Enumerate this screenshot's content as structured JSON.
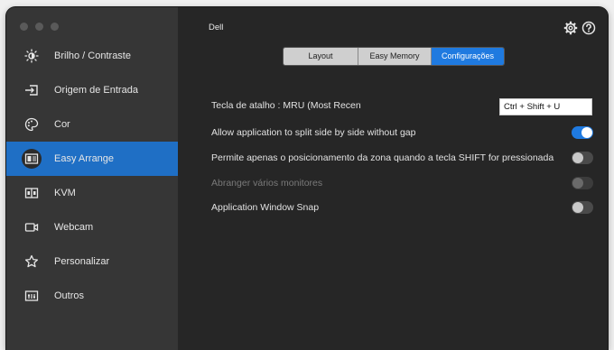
{
  "window": {
    "title": "Dell"
  },
  "sidebar": {
    "items": [
      {
        "label": "Brilho / Contraste",
        "icon": "brightness-icon",
        "active": false
      },
      {
        "label": "Origem de Entrada",
        "icon": "input-source-icon",
        "active": false
      },
      {
        "label": "Cor",
        "icon": "palette-icon",
        "active": false
      },
      {
        "label": "Easy Arrange",
        "icon": "easy-arrange-icon",
        "active": true
      },
      {
        "label": "KVM",
        "icon": "kvm-icon",
        "active": false
      },
      {
        "label": "Webcam",
        "icon": "webcam-icon",
        "active": false
      },
      {
        "label": "Personalizar",
        "icon": "star-icon",
        "active": false
      },
      {
        "label": "Outros",
        "icon": "others-icon",
        "active": false
      }
    ]
  },
  "header": {
    "settings_icon": "gear-icon",
    "help_icon": "help-icon"
  },
  "tabs": [
    {
      "label": "Layout",
      "active": false
    },
    {
      "label": "Easy Memory",
      "active": false
    },
    {
      "label": "Configurações",
      "active": true
    }
  ],
  "settings": {
    "shortcut_label": "Tecla de atalho : MRU (Most Recent Used)",
    "shortcut_value": "Ctrl + Shift + U",
    "rows": [
      {
        "label": "Allow application to split side by side without gap",
        "state": "on"
      },
      {
        "label": "Permite apenas o posicionamento da zona quando a tecla SHIFT for pressionada",
        "state": "off"
      },
      {
        "label": "Abranger vários monitores",
        "state": "disabled"
      },
      {
        "label": "Application Window Snap",
        "state": "off"
      }
    ]
  },
  "colors": {
    "accent": "#1f7ae0",
    "sidebar_active": "#1f6fc5",
    "sidebar_bg": "#363636",
    "main_bg": "#262626"
  }
}
